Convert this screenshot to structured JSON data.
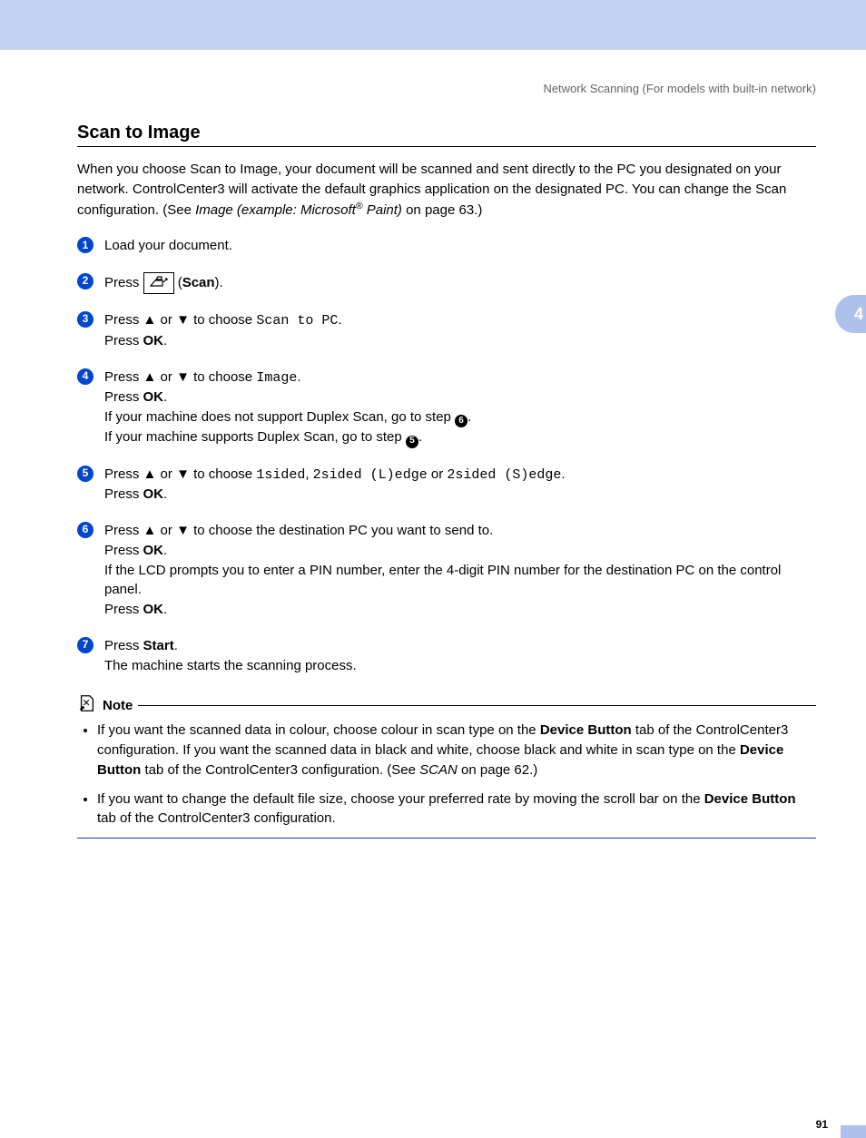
{
  "breadcrumb": "Network Scanning (For models with built-in network)",
  "chapter_tab": "4",
  "page_number": "91",
  "title": "Scan to Image",
  "intro": {
    "t1": "When you choose Scan to Image, your document will be scanned and sent directly to the PC you designated on your network. ControlCenter3 will activate the default graphics application on the designated PC. You can change the Scan configuration. (See ",
    "link": "Image (example: Microsoft",
    "reg": "®",
    "link_after": " Paint)",
    "t2": " on page 63.)"
  },
  "steps": {
    "s1": "Load your document.",
    "s2": {
      "press": "Press ",
      "scan_open": " (",
      "scan": "Scan",
      "scan_close": ")."
    },
    "s3": {
      "a": "Press ",
      "b": " or ",
      "c": " to choose ",
      "code": "Scan to PC",
      "d": ".",
      "e": "Press ",
      "ok": "OK",
      "f": "."
    },
    "s4": {
      "a": "Press ",
      "b": " or ",
      "c": " to choose ",
      "code": "Image",
      "d": ".",
      "e": "Press ",
      "ok": "OK",
      "f": ".",
      "g": "If your machine does not support Duplex Scan, go to step ",
      "h": ".",
      "i": "If your machine supports Duplex Scan, go to step ",
      "j": "."
    },
    "s5": {
      "a": "Press ",
      "b": " or ",
      "c": " to choose ",
      "c1": "1sided",
      "comma1": ", ",
      "c2": "2sided (L)edge",
      "or": " or ",
      "c3": "2sided (S)edge",
      "dot": ".",
      "e": "Press ",
      "ok": "OK",
      "f": "."
    },
    "s6": {
      "a": "Press ",
      "b": " or ",
      "c": " to choose the destination PC you want to send to.",
      "e": "Press ",
      "ok": "OK",
      "f": ".",
      "g": "If the LCD prompts you to enter a PIN number, enter the 4-digit PIN number for the destination PC on the control panel.",
      "h": "Press ",
      "ok2": "OK",
      "i": "."
    },
    "s7": {
      "a": "Press ",
      "start": "Start",
      "b": ".",
      "c": "The machine starts the scanning process."
    },
    "ref6": "6",
    "ref5": "5"
  },
  "note": {
    "label": "Note",
    "n1": {
      "a": "If you want the scanned data in colour, choose colour in scan type on the ",
      "db": "Device Button",
      "b": " tab of the ControlCenter3 configuration. If you want the scanned data in black and white, choose black and white in scan type on the ",
      "db2": "Device Button",
      "c": " tab of the ControlCenter3 configuration. (See ",
      "scan": "SCAN",
      "d": " on page 62.)"
    },
    "n2": {
      "a": "If you want to change the default file size, choose your preferred rate by moving the scroll bar on the ",
      "db": "Device Button",
      "b": " tab of the ControlCenter3 configuration."
    }
  }
}
